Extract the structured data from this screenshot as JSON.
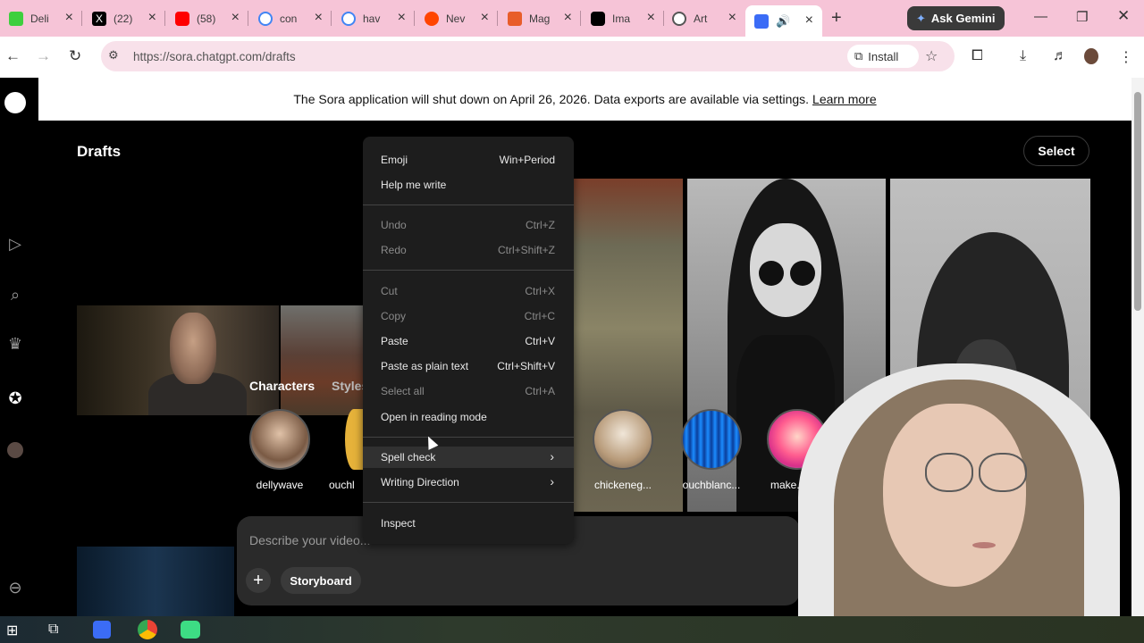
{
  "browser": {
    "tabs": [
      {
        "title": "Deli",
        "icon": "k-logo-icon",
        "color": "#3ecf3e"
      },
      {
        "title": "(22)",
        "icon": "x-logo-icon",
        "color": "#000000"
      },
      {
        "title": "(58)",
        "icon": "youtube-icon",
        "color": "#ff0000"
      },
      {
        "title": "con",
        "icon": "google-icon",
        "color": "#4285f4"
      },
      {
        "title": "hav",
        "icon": "google-icon",
        "color": "#4285f4"
      },
      {
        "title": "Nev",
        "icon": "reddit-icon",
        "color": "#ff4500"
      },
      {
        "title": "Mag",
        "icon": "s-logo-icon",
        "color": "#e85d2a"
      },
      {
        "title": "Ima",
        "icon": "openai-icon",
        "color": "#000000"
      },
      {
        "title": "Art",
        "icon": "openai-icon",
        "color": "#555555"
      },
      {
        "title": "",
        "icon": "sora-icon",
        "color": "#3b6cf6",
        "active": true
      }
    ],
    "new_tab": "+",
    "gemini_label": "Ask Gemini",
    "url": "https://sora.chatgpt.com/drafts",
    "install_label": "Install"
  },
  "banner": {
    "text": "The Sora application will shut down on April 26, 2026. Data exports are available via settings.",
    "link": "Learn more"
  },
  "page": {
    "title": "Drafts",
    "select_label": "Select",
    "tabs": [
      "Characters",
      "Styles"
    ],
    "characters": [
      "dellywave",
      "ouchl",
      "chickeneg...",
      "ouchblanc...",
      "make.a.wis"
    ],
    "prompt_placeholder": "Describe your video...",
    "storyboard_label": "Storyboard",
    "plus_label": "+"
  },
  "context_menu": {
    "items": [
      {
        "label": "Emoji",
        "shortcut": "Win+Period",
        "disabled": false
      },
      {
        "label": "Help me write",
        "shortcut": "",
        "disabled": false
      },
      {
        "label": "Undo",
        "shortcut": "Ctrl+Z",
        "disabled": true
      },
      {
        "label": "Redo",
        "shortcut": "Ctrl+Shift+Z",
        "disabled": true
      },
      {
        "label": "Cut",
        "shortcut": "Ctrl+X",
        "disabled": true
      },
      {
        "label": "Copy",
        "shortcut": "Ctrl+C",
        "disabled": true
      },
      {
        "label": "Paste",
        "shortcut": "Ctrl+V",
        "disabled": false
      },
      {
        "label": "Paste as plain text",
        "shortcut": "Ctrl+Shift+V",
        "disabled": false
      },
      {
        "label": "Select all",
        "shortcut": "Ctrl+A",
        "disabled": true
      },
      {
        "label": "Open in reading mode",
        "shortcut": "",
        "disabled": false
      },
      {
        "label": "Spell check",
        "shortcut": "",
        "disabled": false,
        "submenu": true
      },
      {
        "label": "Writing Direction",
        "shortcut": "",
        "disabled": false,
        "submenu": true
      },
      {
        "label": "Inspect",
        "shortcut": "",
        "disabled": false
      }
    ]
  },
  "colors": {
    "tabstrip": "#f6c4d7",
    "menu_bg": "#1d1d1d",
    "page_bg": "#000000"
  }
}
